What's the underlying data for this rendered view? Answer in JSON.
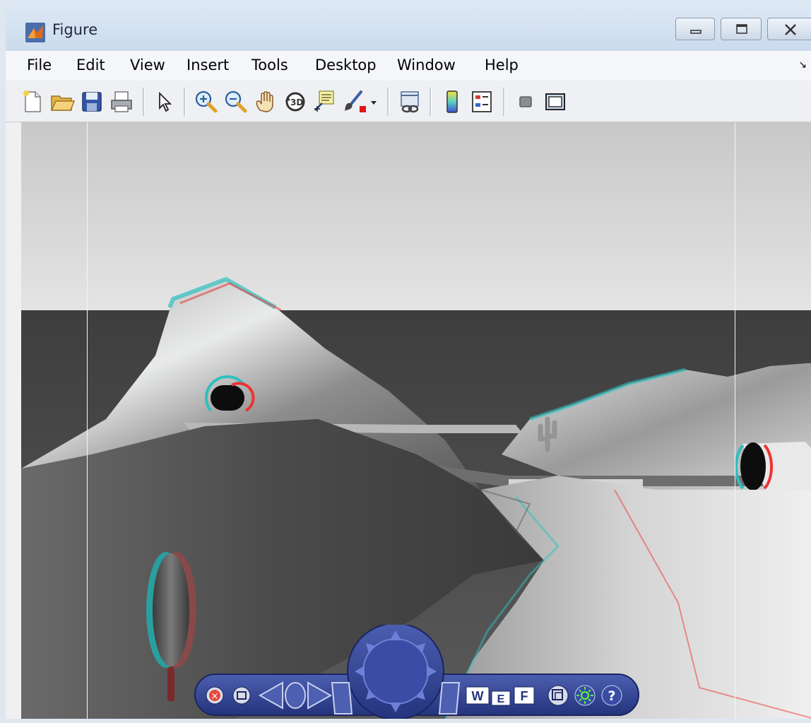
{
  "window": {
    "title": "Figure",
    "controls": {
      "minimize": "minimize",
      "maximize": "maximize",
      "close": "close"
    }
  },
  "menubar": {
    "items": [
      "File",
      "Edit",
      "View",
      "Insert",
      "Tools",
      "Desktop",
      "Window",
      "Help"
    ],
    "dock_arrow": "↘"
  },
  "toolbar": {
    "icons": [
      "new-figure-icon",
      "open-file-icon",
      "save-icon",
      "print-icon",
      "pointer-icon",
      "zoom-in-icon",
      "zoom-out-icon",
      "pan-hand-icon",
      "rotate-3d-icon",
      "data-cursor-icon",
      "brush-icon",
      "link-plot-icon",
      "colorbar-icon",
      "legend-icon",
      "hide-plot-tools-icon",
      "show-plot-tools-icon"
    ]
  },
  "navigation_panel": {
    "buttons": {
      "close": "×",
      "restore": "▭",
      "view_w": "W",
      "view_e": "E",
      "view_f": "F"
    },
    "help": "?"
  }
}
